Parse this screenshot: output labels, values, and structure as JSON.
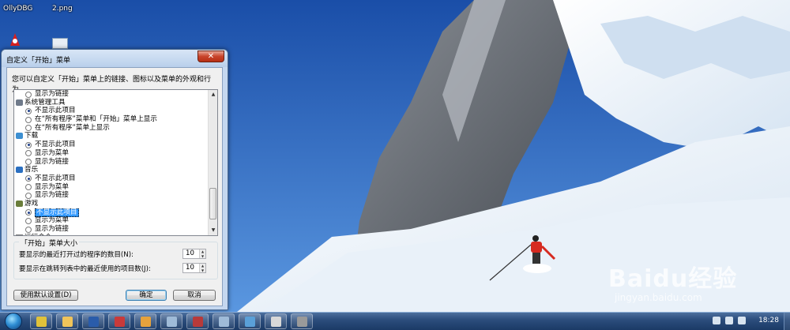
{
  "desktop": {
    "labels": [
      "OllyDBG",
      "2.png"
    ]
  },
  "dialog": {
    "title": "自定义「开始」菜单",
    "close_glyph": "✕",
    "description": "您可以自定义「开始」菜单上的链接、图标以及菜单的外观和行为。",
    "list": [
      {
        "kind": "opt",
        "label": "显示为链接",
        "checked": false
      },
      {
        "kind": "cat",
        "label": "系统管理工具",
        "icon": "admin-tools-icon",
        "color": "#6f7a8a"
      },
      {
        "kind": "opt",
        "label": "不显示此项目",
        "checked": true
      },
      {
        "kind": "opt",
        "label": "在“所有程序”菜单和「开始」菜单上显示",
        "checked": false
      },
      {
        "kind": "opt",
        "label": "在“所有程序”菜单上显示",
        "checked": false
      },
      {
        "kind": "cat",
        "label": "下载",
        "icon": "download-folder-icon",
        "color": "#3d8fd1"
      },
      {
        "kind": "opt",
        "label": "不显示此项目",
        "checked": true
      },
      {
        "kind": "opt",
        "label": "显示为菜单",
        "checked": false
      },
      {
        "kind": "opt",
        "label": "显示为链接",
        "checked": false
      },
      {
        "kind": "cat",
        "label": "音乐",
        "icon": "music-icon",
        "color": "#2a6fc1"
      },
      {
        "kind": "opt",
        "label": "不显示此项目",
        "checked": true
      },
      {
        "kind": "opt",
        "label": "显示为菜单",
        "checked": false
      },
      {
        "kind": "opt",
        "label": "显示为链接",
        "checked": false
      },
      {
        "kind": "cat",
        "label": "游戏",
        "icon": "games-icon",
        "color": "#6a7d3a"
      },
      {
        "kind": "opt",
        "label": "不显示此项目",
        "checked": true,
        "selected": true
      },
      {
        "kind": "opt",
        "label": "显示为菜单",
        "checked": false
      },
      {
        "kind": "opt",
        "label": "显示为链接",
        "checked": false
      },
      {
        "kind": "chk",
        "label": "运行命令",
        "checked": true
      }
    ],
    "size_group": {
      "legend": "「开始」菜单大小",
      "recent_programs_label": "要显示的最近打开过的程序的数目(N):",
      "recent_programs_value": "10",
      "jumplist_label": "要显示在跳转列表中的最近使用的项目数(J):",
      "jumplist_value": "10"
    },
    "buttons": {
      "default_label": "使用默认设置(D)",
      "ok_label": "确定",
      "cancel_label": "取消"
    }
  },
  "taskbar": {
    "clock": "18:28",
    "items": [
      {
        "icon": "chrome-icon",
        "color": "#e0c23a"
      },
      {
        "icon": "explorer-icon",
        "color": "#f0c45a"
      },
      {
        "icon": "word-icon",
        "color": "#2a5caa"
      },
      {
        "icon": "app-icon",
        "color": "#c93a3a"
      },
      {
        "icon": "folder-icon",
        "color": "#e6a23c"
      },
      {
        "icon": "window-icon",
        "color": "#9fbbd8"
      },
      {
        "icon": "tool-icon",
        "color": "#b83a3a"
      },
      {
        "icon": "window-icon",
        "color": "#9fbbd8"
      },
      {
        "icon": "control-panel-icon",
        "color": "#5aa0d8"
      },
      {
        "icon": "image-icon",
        "color": "#d8d8d8"
      },
      {
        "icon": "app-icon",
        "color": "#9a9a9a"
      }
    ]
  },
  "watermark": {
    "brand": "Baidu经验",
    "url": "jingyan.baidu.com"
  }
}
